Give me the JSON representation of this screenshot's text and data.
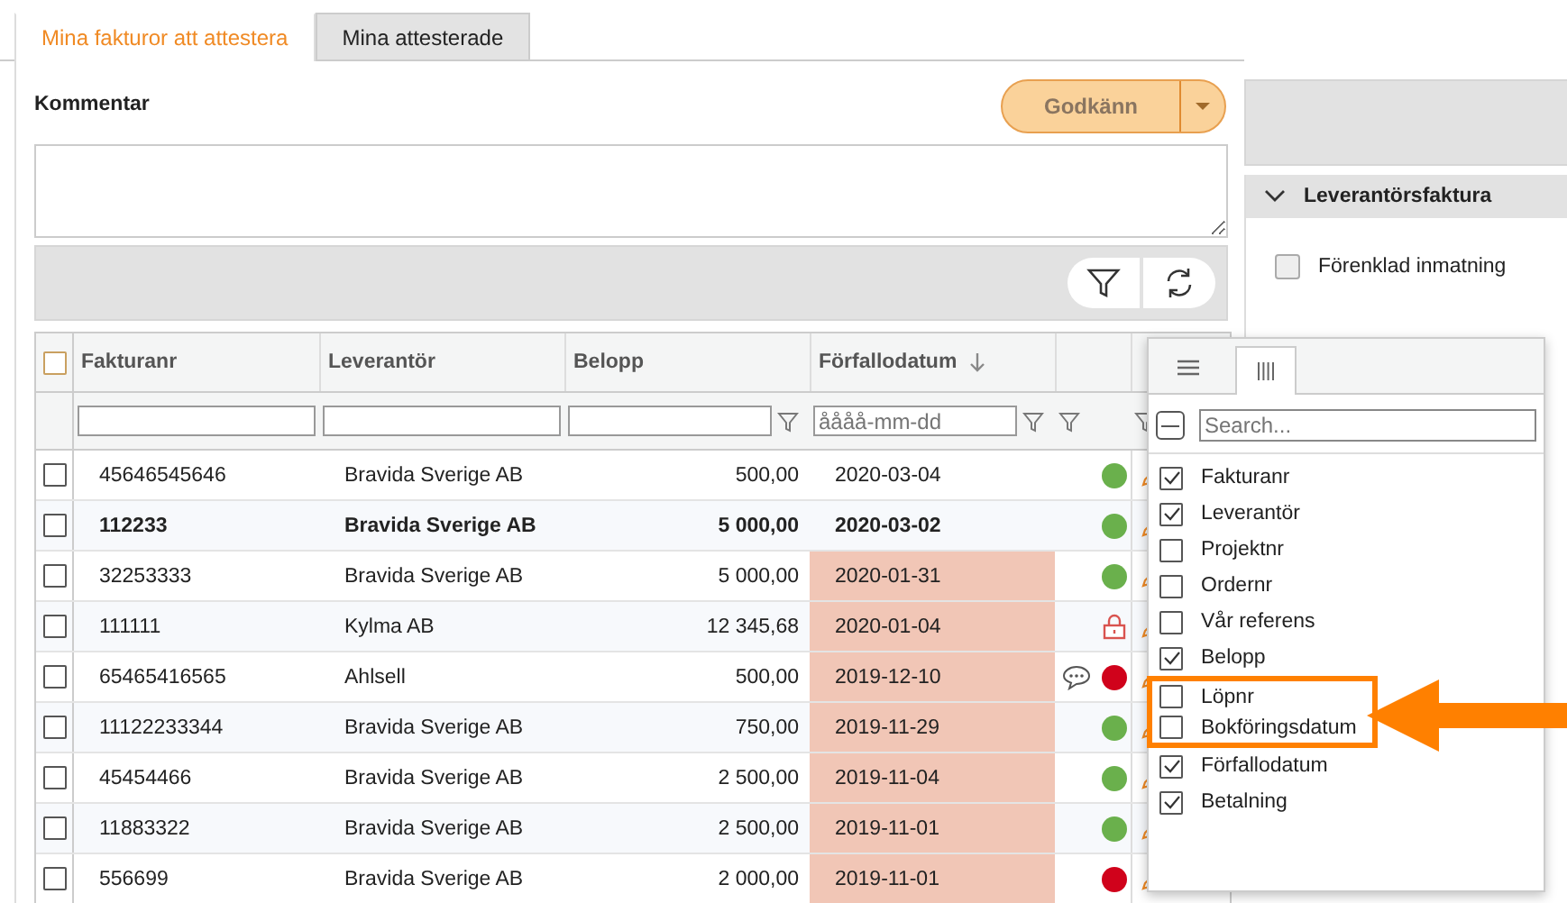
{
  "tabs": [
    {
      "label": "Mina fakturor att attestera",
      "selected": true
    },
    {
      "label": "Mina attesterade",
      "selected": false
    }
  ],
  "comment": {
    "label": "Kommentar"
  },
  "approve_button": {
    "label": "Godkänn"
  },
  "table": {
    "all_checked": false,
    "columns": [
      {
        "label": "Fakturanr",
        "sorted": false
      },
      {
        "label": "Leverantör",
        "sorted": false
      },
      {
        "label": "Belopp",
        "sorted": false
      },
      {
        "label": "Förfallodatum",
        "placeholder": "åååå-mm-dd",
        "sorted": true
      }
    ],
    "rows": [
      {
        "cells": [
          "45646545646",
          "Bravida Sverige AB",
          "500,00",
          "2020-03-04"
        ],
        "checked": false,
        "unread": false,
        "overdue": false,
        "locked": false,
        "color": "#6ab04c",
        "comment": false
      },
      {
        "cells": [
          "112233",
          "Bravida Sverige AB",
          "5 000,00",
          "2020-03-02"
        ],
        "checked": false,
        "unread": true,
        "overdue": false,
        "locked": false,
        "color": "#6ab04c",
        "comment": false
      },
      {
        "cells": [
          "32253333",
          "Bravida Sverige AB",
          "5 000,00",
          "2020-01-31"
        ],
        "checked": false,
        "unread": false,
        "overdue": true,
        "locked": false,
        "color": "#6ab04c",
        "comment": false
      },
      {
        "cells": [
          "111111",
          "Kylma AB",
          "12 345,68",
          "2020-01-04"
        ],
        "checked": false,
        "unread": false,
        "overdue": true,
        "locked": true,
        "comment": false
      },
      {
        "cells": [
          "65465416565",
          "Ahlsell",
          "500,00",
          "2019-12-10"
        ],
        "checked": false,
        "unread": false,
        "overdue": true,
        "locked": false,
        "color": "#d0021b",
        "comment": true
      },
      {
        "cells": [
          "11122233344",
          "Bravida Sverige AB",
          "750,00",
          "2019-11-29"
        ],
        "checked": false,
        "unread": false,
        "overdue": true,
        "locked": false,
        "color": "#6ab04c",
        "comment": false
      },
      {
        "cells": [
          "45454466",
          "Bravida Sverige AB",
          "2 500,00",
          "2019-11-04"
        ],
        "checked": false,
        "unread": false,
        "overdue": true,
        "locked": false,
        "color": "#6ab04c",
        "comment": false
      },
      {
        "cells": [
          "11883322",
          "Bravida Sverige AB",
          "2 500,00",
          "2019-11-01"
        ],
        "checked": false,
        "unread": false,
        "overdue": true,
        "locked": false,
        "color": "#6ab04c",
        "comment": false
      },
      {
        "cells": [
          "556699",
          "Bravida Sverige AB",
          "2 000,00",
          "2019-11-01"
        ],
        "checked": false,
        "unread": false,
        "overdue": true,
        "locked": false,
        "color": "#d0021b",
        "comment": false
      }
    ]
  },
  "side_panel": {
    "section": "Leverantörsfaktura",
    "expanded": true,
    "simple_entry": {
      "label": "Förenklad inmatning",
      "checked": false
    }
  },
  "column_menu": {
    "indeterminate": true,
    "search_placeholder": "Search...",
    "items": [
      {
        "label": "Fakturanr",
        "checked": true,
        "highlighted": false
      },
      {
        "label": "Leverantör",
        "checked": true,
        "highlighted": false
      },
      {
        "label": "Projektnr",
        "checked": false,
        "highlighted": false
      },
      {
        "label": "Ordernr",
        "checked": false,
        "highlighted": false
      },
      {
        "label": "Vår referens",
        "checked": false,
        "highlighted": false
      },
      {
        "label": "Belopp",
        "checked": true,
        "highlighted": false
      },
      {
        "label": "Löpnr",
        "checked": false,
        "highlighted": true
      },
      {
        "label": "Bokföringsdatum",
        "checked": false,
        "highlighted": true
      },
      {
        "label": "Förfallodatum",
        "checked": true,
        "highlighted": false
      },
      {
        "label": "Betalning",
        "checked": true,
        "highlighted": false
      }
    ]
  }
}
